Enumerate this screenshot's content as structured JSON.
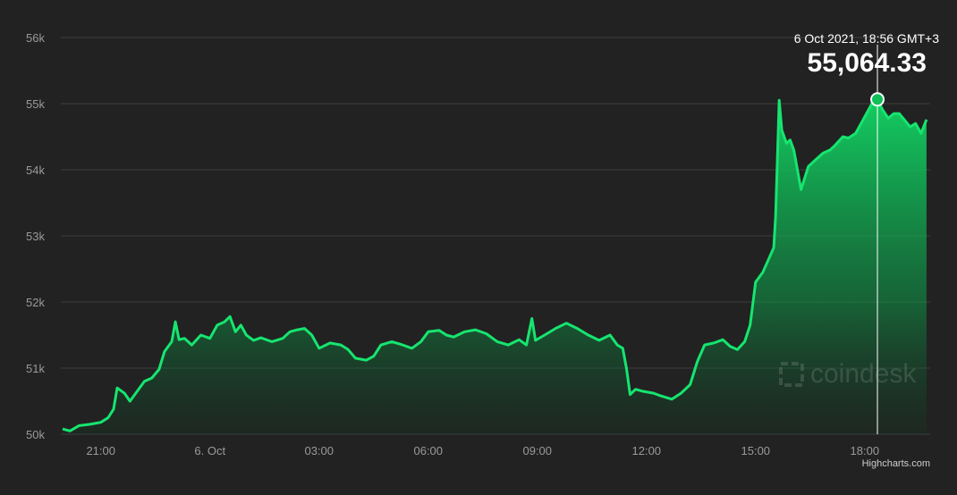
{
  "chart_data": {
    "type": "area",
    "y_ticks": [
      {
        "value": 50000,
        "label": "50k"
      },
      {
        "value": 51000,
        "label": "51k"
      },
      {
        "value": 52000,
        "label": "52k"
      },
      {
        "value": 53000,
        "label": "53k"
      },
      {
        "value": 54000,
        "label": "54k"
      },
      {
        "value": 55000,
        "label": "55k"
      },
      {
        "value": 56000,
        "label": "56k"
      }
    ],
    "x_ticks": [
      {
        "hour": 21,
        "label": "21:00"
      },
      {
        "hour": 24,
        "label": "6. Oct"
      },
      {
        "hour": 27,
        "label": "03:00"
      },
      {
        "hour": 30,
        "label": "06:00"
      },
      {
        "hour": 33,
        "label": "09:00"
      },
      {
        "hour": 36,
        "label": "12:00"
      },
      {
        "hour": 39,
        "label": "15:00"
      },
      {
        "hour": 42,
        "label": "18:00"
      }
    ],
    "x_range": [
      19.9,
      43.8
    ],
    "ylim": [
      50000,
      56000
    ],
    "grid": true,
    "series": [
      {
        "points": [
          [
            19.95,
            50080
          ],
          [
            20.15,
            50050
          ],
          [
            20.4,
            50130
          ],
          [
            20.7,
            50150
          ],
          [
            21.0,
            50180
          ],
          [
            21.2,
            50250
          ],
          [
            21.35,
            50380
          ],
          [
            21.45,
            50700
          ],
          [
            21.65,
            50620
          ],
          [
            21.8,
            50500
          ],
          [
            22.0,
            50650
          ],
          [
            22.2,
            50800
          ],
          [
            22.4,
            50850
          ],
          [
            22.6,
            50980
          ],
          [
            22.75,
            51250
          ],
          [
            22.95,
            51400
          ],
          [
            23.05,
            51700
          ],
          [
            23.15,
            51430
          ],
          [
            23.3,
            51450
          ],
          [
            23.5,
            51350
          ],
          [
            23.75,
            51500
          ],
          [
            24.0,
            51450
          ],
          [
            24.2,
            51650
          ],
          [
            24.4,
            51700
          ],
          [
            24.55,
            51780
          ],
          [
            24.7,
            51550
          ],
          [
            24.85,
            51650
          ],
          [
            25.0,
            51500
          ],
          [
            25.2,
            51420
          ],
          [
            25.4,
            51460
          ],
          [
            25.7,
            51400
          ],
          [
            26.0,
            51450
          ],
          [
            26.2,
            51550
          ],
          [
            26.4,
            51580
          ],
          [
            26.6,
            51600
          ],
          [
            26.8,
            51500
          ],
          [
            27.0,
            51300
          ],
          [
            27.3,
            51380
          ],
          [
            27.6,
            51350
          ],
          [
            27.8,
            51280
          ],
          [
            28.0,
            51150
          ],
          [
            28.3,
            51120
          ],
          [
            28.5,
            51180
          ],
          [
            28.7,
            51350
          ],
          [
            29.0,
            51400
          ],
          [
            29.3,
            51350
          ],
          [
            29.55,
            51300
          ],
          [
            29.8,
            51400
          ],
          [
            30.0,
            51550
          ],
          [
            30.3,
            51570
          ],
          [
            30.5,
            51500
          ],
          [
            30.7,
            51470
          ],
          [
            31.0,
            51550
          ],
          [
            31.3,
            51580
          ],
          [
            31.6,
            51520
          ],
          [
            31.9,
            51400
          ],
          [
            32.2,
            51350
          ],
          [
            32.5,
            51430
          ],
          [
            32.7,
            51350
          ],
          [
            32.85,
            51750
          ],
          [
            32.95,
            51420
          ],
          [
            33.2,
            51500
          ],
          [
            33.5,
            51600
          ],
          [
            33.8,
            51680
          ],
          [
            34.1,
            51600
          ],
          [
            34.4,
            51500
          ],
          [
            34.7,
            51420
          ],
          [
            35.0,
            51500
          ],
          [
            35.2,
            51350
          ],
          [
            35.35,
            51300
          ],
          [
            35.45,
            51000
          ],
          [
            35.55,
            50600
          ],
          [
            35.7,
            50680
          ],
          [
            35.9,
            50650
          ],
          [
            36.2,
            50620
          ],
          [
            36.4,
            50580
          ],
          [
            36.7,
            50530
          ],
          [
            36.95,
            50620
          ],
          [
            37.2,
            50750
          ],
          [
            37.4,
            51100
          ],
          [
            37.6,
            51350
          ],
          [
            37.85,
            51380
          ],
          [
            38.1,
            51430
          ],
          [
            38.3,
            51330
          ],
          [
            38.5,
            51280
          ],
          [
            38.7,
            51400
          ],
          [
            38.85,
            51650
          ],
          [
            39.0,
            52300
          ],
          [
            39.2,
            52450
          ],
          [
            39.4,
            52700
          ],
          [
            39.5,
            52820
          ],
          [
            39.55,
            53300
          ],
          [
            39.65,
            55050
          ],
          [
            39.72,
            54600
          ],
          [
            39.85,
            54400
          ],
          [
            39.95,
            54450
          ],
          [
            40.05,
            54300
          ],
          [
            40.15,
            54000
          ],
          [
            40.25,
            53700
          ],
          [
            40.45,
            54050
          ],
          [
            40.65,
            54150
          ],
          [
            40.85,
            54250
          ],
          [
            41.05,
            54300
          ],
          [
            41.2,
            54380
          ],
          [
            41.4,
            54500
          ],
          [
            41.55,
            54480
          ],
          [
            41.75,
            54550
          ],
          [
            41.95,
            54750
          ],
          [
            42.05,
            54850
          ],
          [
            42.2,
            55000
          ],
          [
            42.35,
            55064
          ],
          [
            42.5,
            54900
          ],
          [
            42.65,
            54780
          ],
          [
            42.8,
            54850
          ],
          [
            42.95,
            54850
          ],
          [
            43.1,
            54750
          ],
          [
            43.25,
            54650
          ],
          [
            43.4,
            54700
          ],
          [
            43.55,
            54550
          ],
          [
            43.7,
            54760
          ]
        ]
      }
    ],
    "tooltip": {
      "date_label": "6 Oct 2021, 18:56 GMT+3",
      "value_label": "55,064.33",
      "hour": 42.35,
      "value": 55064.33
    },
    "credits": "Highcharts.com",
    "watermark": "coindesk"
  },
  "colors": {
    "background": "#222222",
    "line": "#16e56f",
    "fill_top": "#0fbf58",
    "grid": "#3d3d3d",
    "axis_text": "#9a9a9a",
    "crosshair": "#ffffff"
  }
}
